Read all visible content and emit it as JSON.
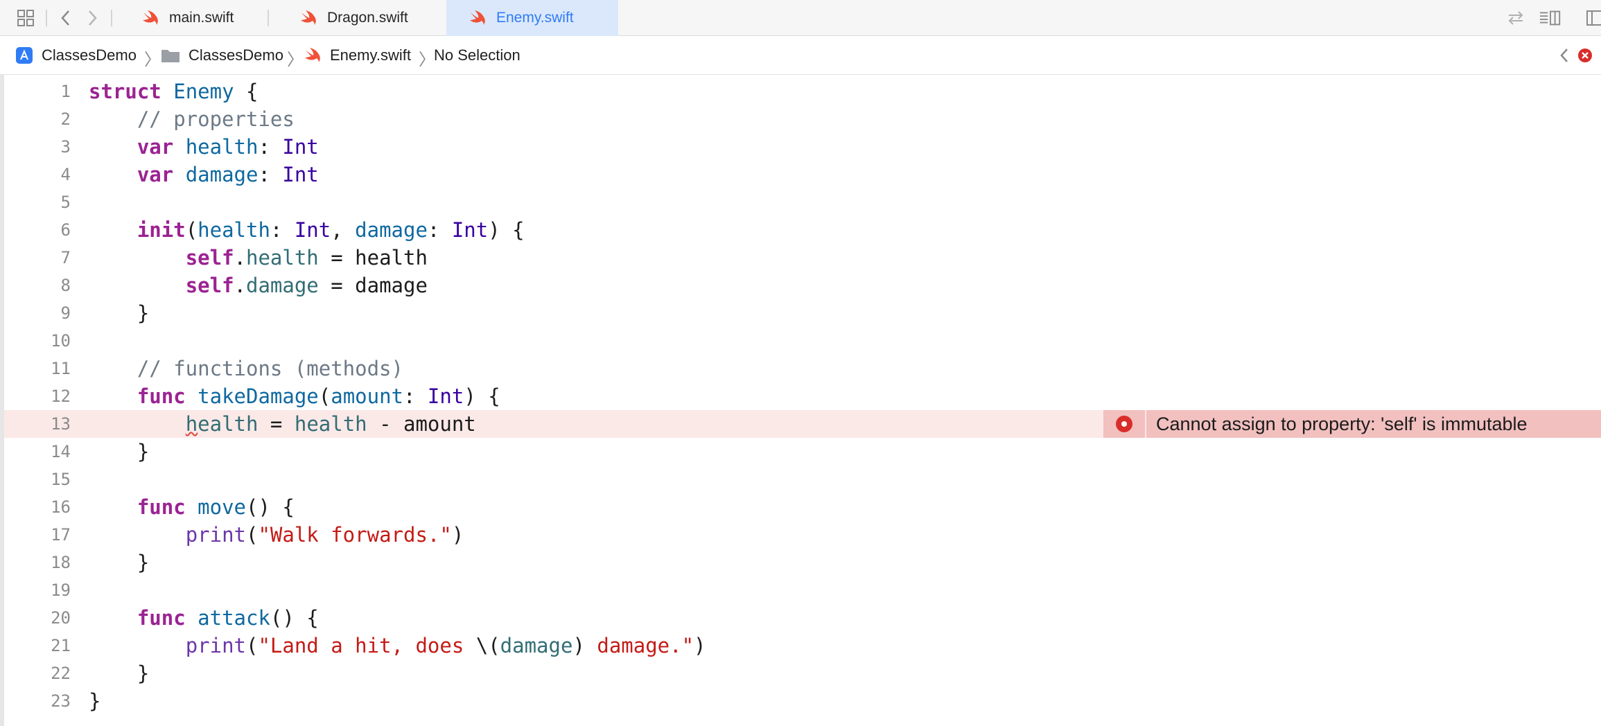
{
  "tabs": [
    {
      "label": "main.swift",
      "active": false
    },
    {
      "label": "Dragon.swift",
      "active": false
    },
    {
      "label": "Enemy.swift",
      "active": true
    }
  ],
  "breadcrumb": {
    "project": "ClassesDemo",
    "folder": "ClassesDemo",
    "file": "Enemy.swift",
    "selection": "No Selection"
  },
  "editor": {
    "line_numbers": [
      "1",
      "2",
      "3",
      "4",
      "5",
      "6",
      "7",
      "8",
      "9",
      "10",
      "11",
      "12",
      "13",
      "14",
      "15",
      "16",
      "17",
      "18",
      "19",
      "20",
      "21",
      "22",
      "23"
    ],
    "code": {
      "l1_struct": "struct",
      "l1_name": "Enemy",
      "l1_brace": " {",
      "l2_comment": "// properties",
      "l3_var": "var",
      "l3_name": "health",
      "l3_colon": ": ",
      "l3_type": "Int",
      "l4_var": "var",
      "l4_name": "damage",
      "l4_colon": ": ",
      "l4_type": "Int",
      "l6_init": "init",
      "l6_p1": "health",
      "l6_t1": "Int",
      "l6_p2": "damage",
      "l6_t2": "Int",
      "l7_self": "self",
      "l7_prop": "health",
      "l7_rest": " = health",
      "l8_self": "self",
      "l8_prop": "damage",
      "l8_rest": " = damage",
      "close": "}",
      "l11_comment": "// functions (methods)",
      "func": "func",
      "l12_name": "takeDamage",
      "l12_param": "amount",
      "l12_type": "Int",
      "l13_h": "h",
      "l13_ealth": "ealth",
      "l13_eq": " = ",
      "l13_health": "health",
      "l13_rest": " - amount",
      "l16_name": "move",
      "print": "print",
      "l17_str": "\"Walk forwards.\"",
      "l20_name": "attack",
      "l21_str1": "\"Land a hit, does ",
      "l21_interp_open": "\\(",
      "l21_var": "damage",
      "l21_interp_close": ")",
      "l21_str2": " damage.\""
    }
  },
  "error": {
    "line": 13,
    "message": "Cannot assign to property: 'self' is immutable"
  },
  "colors": {
    "keyword": "#9b2393",
    "type": "#3900a0",
    "property": "#326d74",
    "declaration": "#0f68a0",
    "string": "#c41a16",
    "comment": "#6c7986",
    "active_tab": "#2f7cf6",
    "error_line": "#fbe9e8",
    "error_banner": "#f1c0bf",
    "error_icon": "#d92d2a"
  }
}
